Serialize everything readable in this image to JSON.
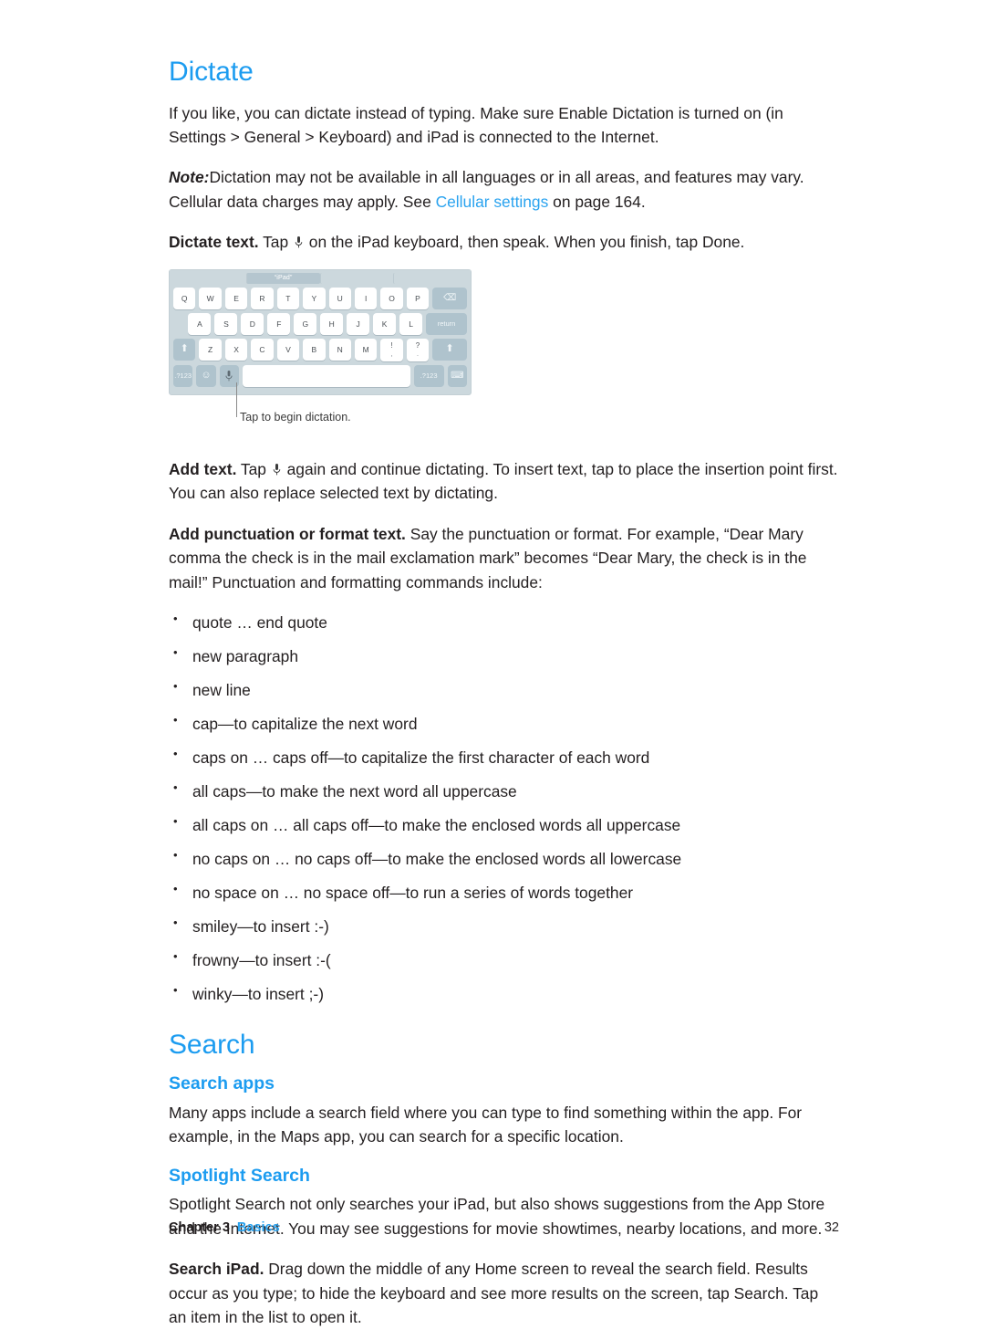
{
  "document": {
    "section1": {
      "heading": "Dictate",
      "intro": "If you like, you can dictate instead of typing. Make sure Enable Dictation is turned on (in Settings > General > Keyboard) and iPad is connected to the Internet.",
      "note_label": "Note:",
      "note_text_before_link": "Dictation may not be available in all languages or in all areas, and features may vary. Cellular data charges may apply. See ",
      "note_link": "Cellular settings",
      "note_text_after_link": " on page 164.",
      "dictate_text_label": "Dictate text.",
      "dictate_text_before_icon": " Tap ",
      "dictate_text_after_icon": " on the iPad keyboard, then speak. When you finish, tap Done.",
      "add_text_label": "Add text.",
      "add_text_before_icon": " Tap ",
      "add_text_after_icon": " again and continue dictating. To insert text, tap to place the insertion point first. You can also replace selected text by dictating.",
      "add_punct_label": "Add punctuation or format text.",
      "add_punct_body": " Say the punctuation or format. For example, “Dear Mary comma the check is in the mail exclamation mark” becomes “Dear Mary, the check is in the mail!” Punctuation and formatting commands include:",
      "commands": [
        "quote … end quote",
        "new paragraph",
        "new line",
        "cap—to capitalize the next word",
        "caps on … caps off—to capitalize the first character of each word",
        "all caps—to make the next word all uppercase",
        "all caps on … all caps off—to make the enclosed words all uppercase",
        "no caps on … no caps off—to make the enclosed words all lowercase",
        "no space on … no space off—to run a series of words together",
        "smiley—to insert :-)",
        "frowny—to insert :-(",
        "winky—to insert ;-)"
      ]
    },
    "figure": {
      "caption": "Tap to begin dictation.",
      "keyboard": {
        "suggestion": "“iPad”",
        "row1": [
          "Q",
          "W",
          "E",
          "R",
          "T",
          "Y",
          "U",
          "I",
          "O",
          "P"
        ],
        "row1_delete": "delete-icon",
        "row2": [
          "A",
          "S",
          "D",
          "F",
          "G",
          "H",
          "J",
          "K",
          "L"
        ],
        "row2_return": "return",
        "row3_shift_left": "shift-icon",
        "row3": [
          "Z",
          "X",
          "C",
          "V",
          "B",
          "N",
          "M"
        ],
        "row3_dual": [
          {
            "upper": "!",
            "lower": ","
          },
          {
            "upper": "?",
            "lower": "."
          }
        ],
        "row3_shift_right": "shift-icon",
        "row4_numbers_left": ".?123",
        "row4_emoji": "emoji-icon",
        "row4_mic": "microphone-icon",
        "row4_space": "",
        "row4_numbers_right": ".?123",
        "row4_hide": "hide-keyboard-icon"
      }
    },
    "section2": {
      "heading": "Search",
      "sub1_heading": "Search apps",
      "sub1_body": "Many apps include a search field where you can type to find something within the app. For example, in the Maps app, you can search for a specific location.",
      "sub2_heading": "Spotlight Search",
      "sub2_body": "Spotlight Search not only searches your iPad, but also shows suggestions from the App Store and the Internet. You may see suggestions for movie showtimes, nearby locations, and more.",
      "search_ipad_label": "Search iPad.",
      "search_ipad_body": " Drag down the middle of any Home screen to reveal the search field. Results occur as you type; to hide the keyboard and see more results on the screen, tap Search. Tap an item in the list to open it."
    },
    "footer": {
      "chapter_label": "Chapter  3",
      "chapter_name": "Basics",
      "page_number": "32"
    },
    "colors": {
      "heading_blue": "#1c9cf0",
      "link_blue": "#2aa3ef",
      "body_text": "#231f20",
      "keyboard_bg": "#ccd8dd",
      "keyboard_fn": "#afc3cd"
    }
  }
}
